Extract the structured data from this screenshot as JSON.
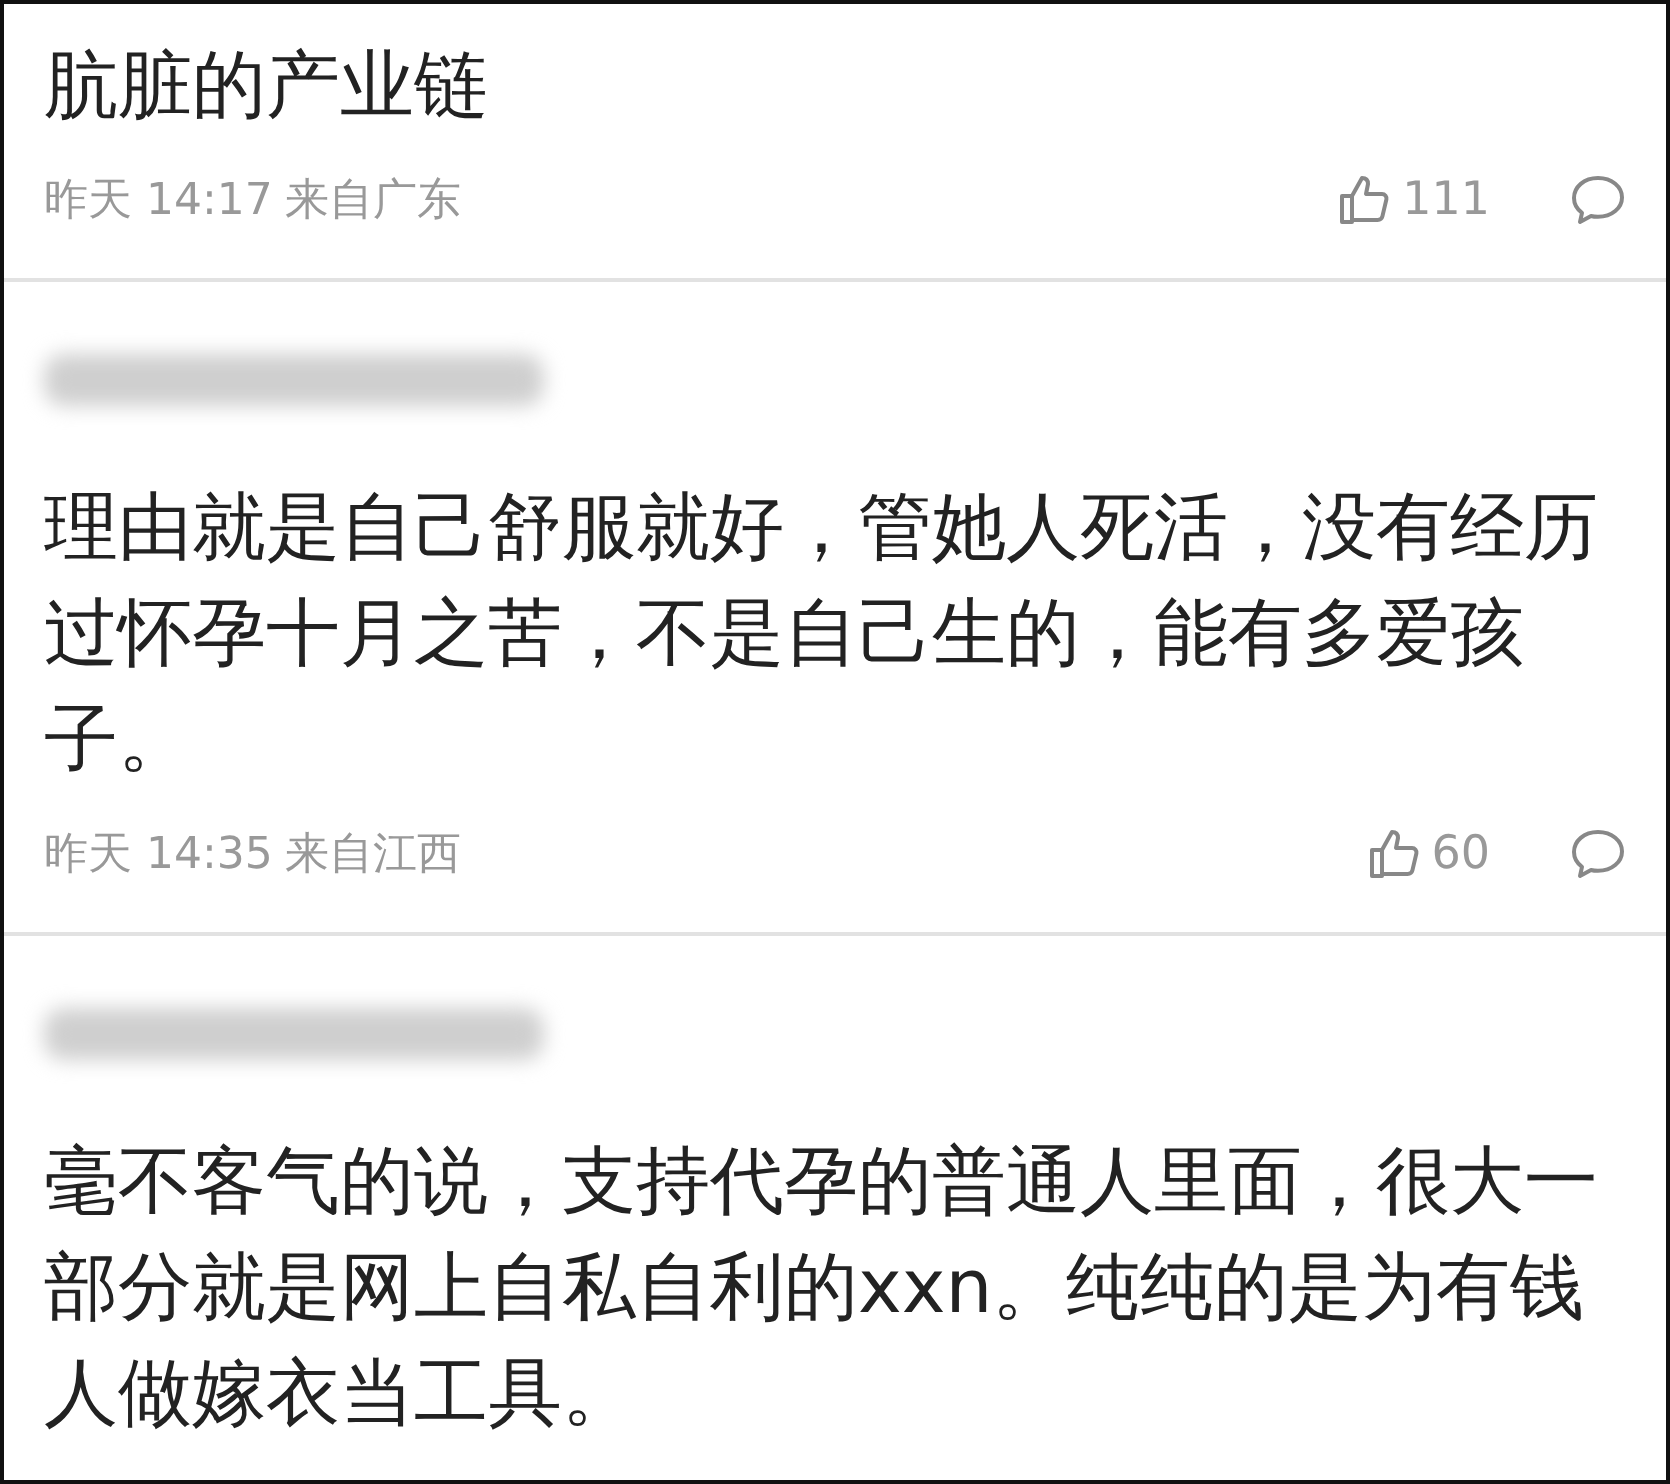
{
  "comments": [
    {
      "text": "肮脏的产业链",
      "meta": {
        "time": "昨天 14:17",
        "location": "来自广东",
        "likes": "111"
      }
    },
    {
      "name_blurred": true,
      "text": "理由就是自己舒服就好，管她人死活，没有经历过怀孕十月之苦，不是自己生的，能有多爱孩子。",
      "meta": {
        "time": "昨天 14:35",
        "location": "来自江西",
        "likes": "60"
      }
    },
    {
      "name_blurred": true,
      "text": "毫不客气的说，支持代孕的普通人里面，很大一部分就是网上自私自利的xxn。纯纯的是为有钱人做嫁衣当工具。"
    }
  ]
}
